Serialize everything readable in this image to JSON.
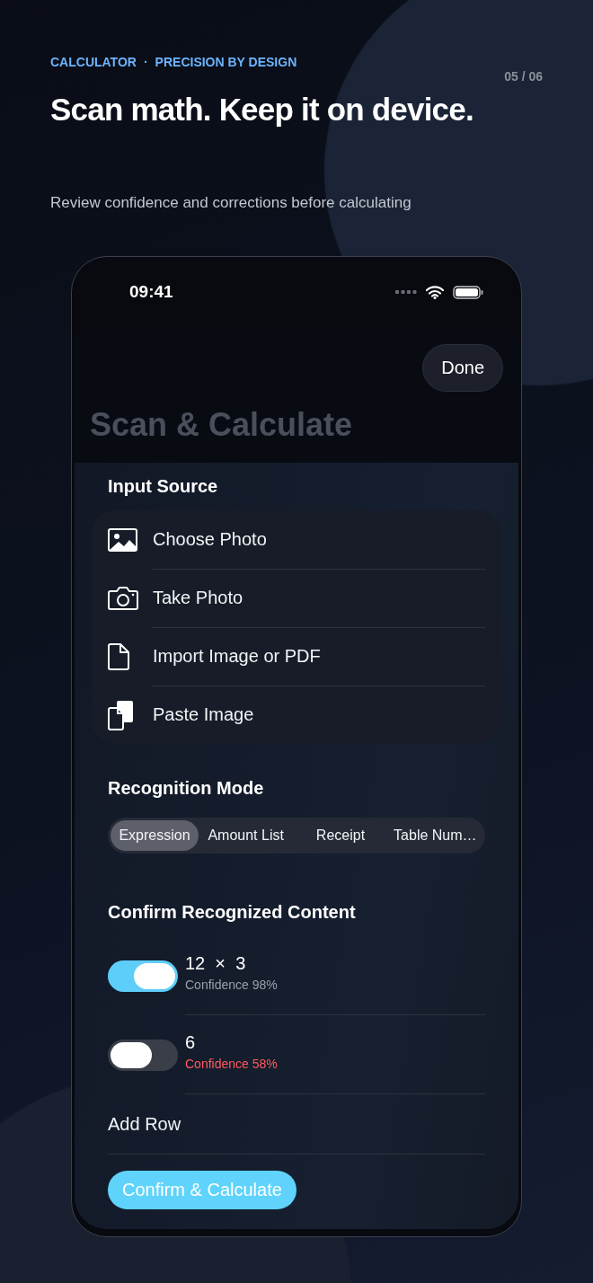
{
  "eyebrow": {
    "product": "CALCULATOR",
    "separator": "·",
    "tagline": "PRECISION BY DESIGN"
  },
  "counter": "05 / 06",
  "headline": "Scan math. Keep it on device.",
  "subtitle": "Review confidence and corrections before calculating",
  "status_bar": {
    "time": "09:41"
  },
  "sheet": {
    "done_button": "Done",
    "title": "Scan & Calculate"
  },
  "input_source": {
    "heading": "Input Source",
    "items": [
      {
        "kind": "photo",
        "label": "Choose Photo"
      },
      {
        "kind": "camera",
        "label": "Take Photo"
      },
      {
        "kind": "document",
        "label": "Import Image or PDF"
      },
      {
        "kind": "paste",
        "label": "Paste Image"
      }
    ]
  },
  "recognition_mode": {
    "heading": "Recognition Mode",
    "segments": [
      {
        "label": "Expression",
        "selected": true
      },
      {
        "label": "Amount List",
        "selected": false
      },
      {
        "label": "Receipt",
        "selected": false
      },
      {
        "label": "Table Num…",
        "selected": false
      }
    ]
  },
  "confirm": {
    "heading": "Confirm Recognized Content",
    "rows": [
      {
        "value": "12  ×  3",
        "confidence": "Confidence 98%",
        "on": true,
        "low_confidence": false
      },
      {
        "value": "6",
        "confidence": "Confidence 58%",
        "on": false,
        "low_confidence": true
      }
    ],
    "add_row": "Add Row",
    "primary_button": "Confirm & Calculate"
  }
}
